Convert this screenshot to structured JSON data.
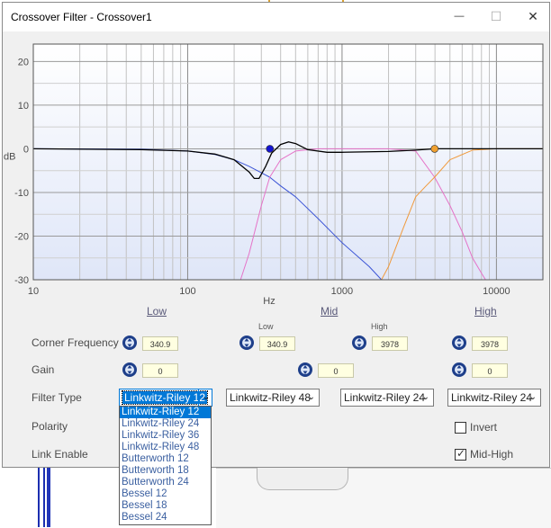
{
  "window": {
    "title": "Crossover Filter - Crossover1",
    "minimize_glyph": "—",
    "maximize_glyph": "☐",
    "close_glyph": "✕"
  },
  "chart_data": {
    "type": "line",
    "xlabel": "Hz",
    "ylabel": "dB",
    "xscale": "log",
    "xlim": [
      10,
      20000
    ],
    "ylim": [
      -30,
      24
    ],
    "x_ticks": [
      "10",
      "100",
      "1000",
      "10000"
    ],
    "y_ticks": [
      "20",
      "10",
      "0",
      "-10",
      "-20",
      "-30"
    ],
    "grid": true,
    "series": [
      {
        "color": "#000000",
        "x": [
          10,
          50,
          100,
          150,
          200,
          250,
          270,
          290,
          320,
          350,
          400,
          450,
          500,
          600,
          800,
          1000,
          2000,
          3000,
          4000,
          6000,
          8000,
          10000,
          20000
        ],
        "y": [
          0,
          -0.2,
          -0.5,
          -1.2,
          -2.5,
          -5.3,
          -6.8,
          -6.8,
          -4,
          -1,
          1,
          1.6,
          1.2,
          -0.2,
          -0.8,
          -0.8,
          -0.6,
          -0.3,
          0,
          0,
          0,
          0,
          0
        ]
      },
      {
        "color": "#3b54d6",
        "x": [
          10,
          50,
          100,
          150,
          200,
          250,
          300,
          340,
          400,
          500,
          700,
          1000,
          1500,
          1800
        ],
        "y": [
          0,
          -0.1,
          -0.5,
          -1.3,
          -2.5,
          -4,
          -5.5,
          -6.5,
          -8.5,
          -11,
          -16,
          -21.5,
          -27,
          -30
        ]
      },
      {
        "color": "#e573c8",
        "x": [
          220,
          250,
          300,
          340,
          400,
          500,
          700,
          1000,
          1500,
          2000,
          3000,
          3978,
          5000,
          6000,
          7000,
          8000,
          8500
        ],
        "y": [
          -30,
          -24,
          -13,
          -6.5,
          -2.5,
          -0.5,
          0,
          0,
          0,
          0,
          -0.5,
          -6.5,
          -13,
          -19,
          -25,
          -28.5,
          -30
        ]
      },
      {
        "color": "#f09a3c",
        "x": [
          1800,
          2000,
          2500,
          3000,
          3500,
          3978,
          5000,
          7000,
          10000,
          20000
        ],
        "y": [
          -30,
          -27,
          -18,
          -11,
          -8.5,
          -6.5,
          -2.5,
          -0.3,
          0,
          0
        ]
      }
    ],
    "points": [
      {
        "x": 340.9,
        "y": 0,
        "color": "#1414d2"
      },
      {
        "x": 3978,
        "y": 0,
        "color": "#f0a030"
      }
    ]
  },
  "bands": {
    "low": "Low",
    "mid": "Mid",
    "high": "High"
  },
  "rows": {
    "corner_frequency": "Corner Frequency",
    "gain": "Gain",
    "filter_type": "Filter Type",
    "polarity": "Polarity",
    "link_enable": "Link Enable"
  },
  "mid_sub": {
    "low": "Low",
    "high": "High"
  },
  "values": {
    "low_corner": "340.9",
    "mid_low_corner": "340.9",
    "mid_high_corner": "3978",
    "high_corner": "3978",
    "low_gain": "0",
    "mid_gain": "0",
    "high_gain": "0"
  },
  "filter_types": {
    "low": "Linkwitz-Riley 12",
    "mid_low": "Linkwitz-Riley 48",
    "mid_high": "Linkwitz-Riley 24",
    "high": "Linkwitz-Riley 24"
  },
  "dropdown_options": [
    "Linkwitz-Riley 12",
    "Linkwitz-Riley 24",
    "Linkwitz-Riley 36",
    "Linkwitz-Riley 48",
    "Butterworth 12",
    "Butterworth 18",
    "Butterworth 24",
    "Bessel 12",
    "Bessel 18",
    "Bessel 24"
  ],
  "checkboxes": {
    "invert": "Invert",
    "mid_high": "Mid-High",
    "invert_checked": false,
    "mid_high_checked": true
  },
  "colors": {
    "plot_bg_top": "#ffffff",
    "plot_bg_bottom": "#dfe6f8",
    "accent": "#0078d7"
  }
}
